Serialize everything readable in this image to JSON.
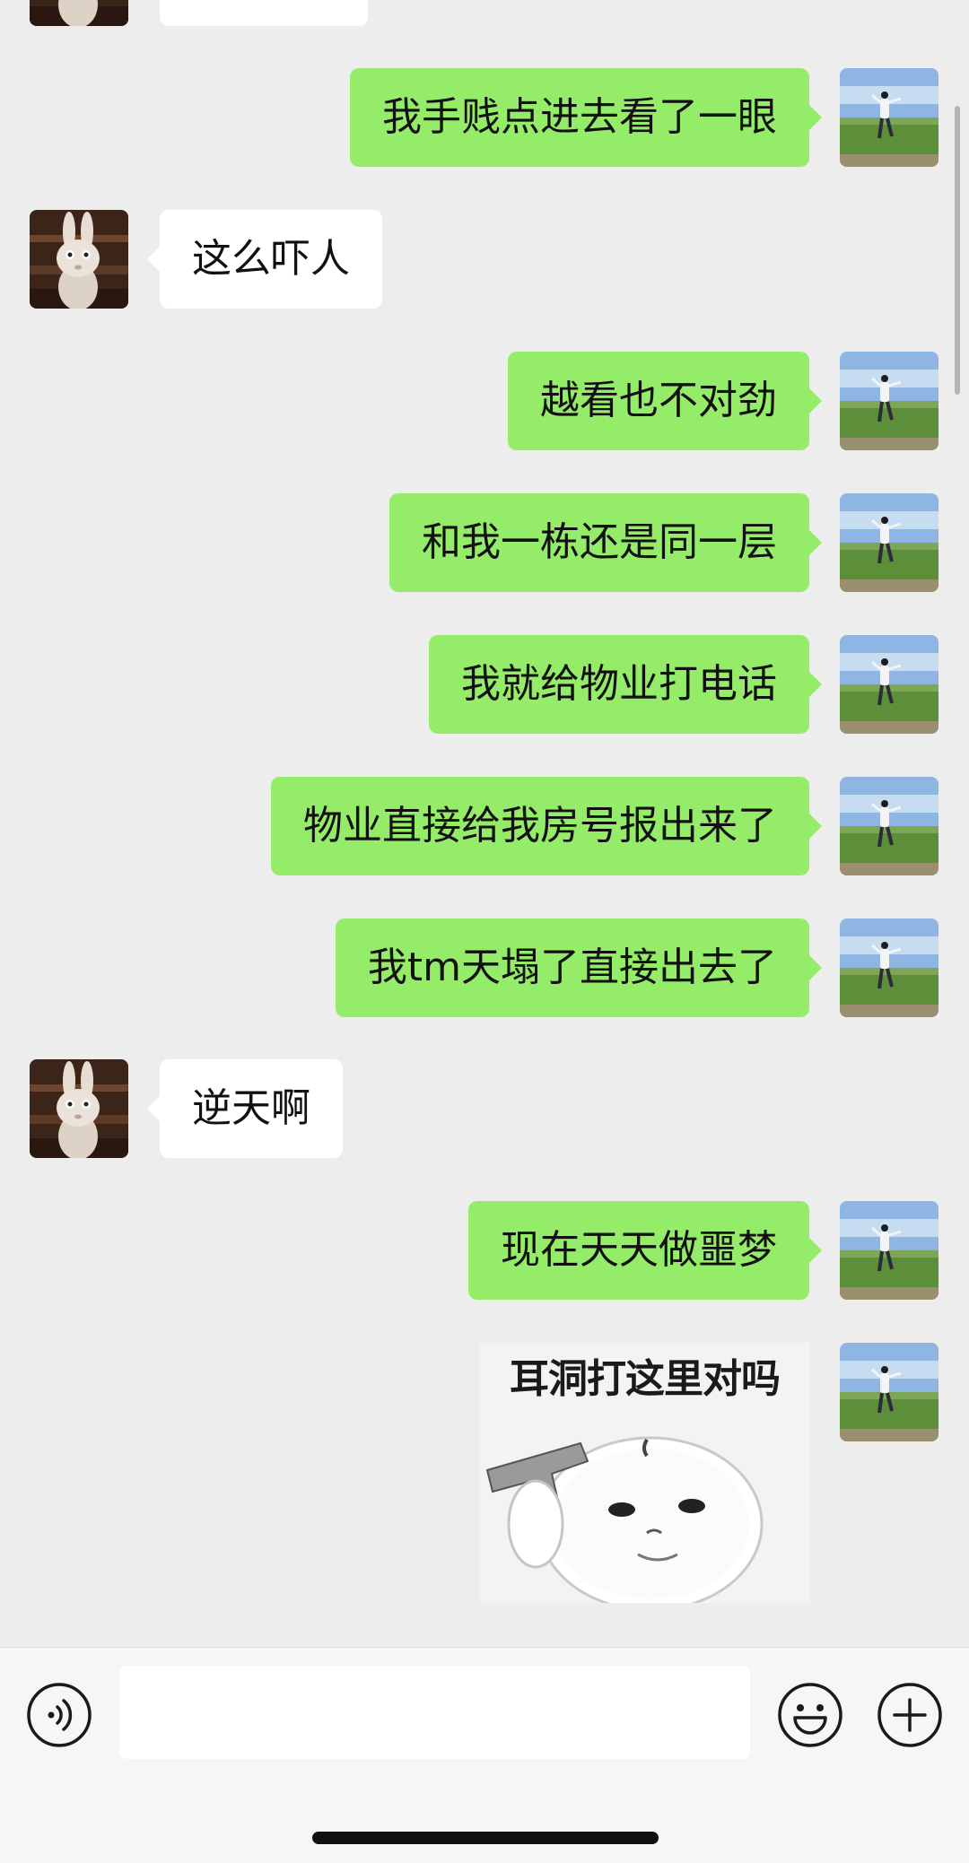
{
  "colors": {
    "background": "#ededed",
    "incoming_bubble": "#ffffff",
    "outgoing_bubble": "#95ec69",
    "input_bar": "#f6f6f6"
  },
  "messages": [
    {
      "direction": "in",
      "text": "",
      "avatar": "rabbit-avatar"
    },
    {
      "direction": "out",
      "text": "我手贱点进去看了一眼",
      "avatar": "field-avatar"
    },
    {
      "direction": "in",
      "text": "这么吓人",
      "avatar": "rabbit-avatar"
    },
    {
      "direction": "out",
      "text": "越看也不对劲",
      "avatar": "field-avatar"
    },
    {
      "direction": "out",
      "text": "和我一栋还是同一层",
      "avatar": "field-avatar"
    },
    {
      "direction": "out",
      "text": "我就给物业打电话",
      "avatar": "field-avatar"
    },
    {
      "direction": "out",
      "text": "物业直接给我房号报出来了",
      "avatar": "field-avatar"
    },
    {
      "direction": "out",
      "text": "我tm天塌了直接出去了",
      "avatar": "field-avatar"
    },
    {
      "direction": "in",
      "text": "逆天啊",
      "avatar": "rabbit-avatar"
    },
    {
      "direction": "out",
      "text": "现在天天做噩梦",
      "avatar": "field-avatar"
    }
  ],
  "sticker": {
    "caption": "耳洞打这里对吗",
    "image": "bunny-with-gun-sticker"
  },
  "input_bar": {
    "message_placeholder": "",
    "voice_icon": "voice-icon",
    "emoji_icon": "emoji-icon",
    "plus_icon": "plus-icon"
  }
}
